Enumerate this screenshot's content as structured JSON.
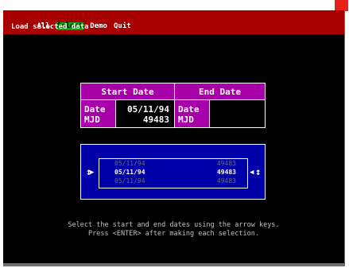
{
  "menu": {
    "items": [
      {
        "label": "All",
        "selected": false
      },
      {
        "label": "Select",
        "selected": true
      },
      {
        "label": "Demo",
        "selected": false
      },
      {
        "label": "Quit",
        "selected": false
      }
    ],
    "description": "Load selected data"
  },
  "dates": {
    "start_header": "Start Date",
    "end_header": "End Date",
    "label_date": "Date",
    "label_mjd": "MJD",
    "start_date": "05/11/94",
    "start_mjd": "49483",
    "end_date": "",
    "end_mjd": ""
  },
  "picker": {
    "rows": [
      {
        "date": "05/11/94",
        "mjd": "49483",
        "state": "dim"
      },
      {
        "date": "05/11/94",
        "mjd": "49483",
        "state": "current"
      },
      {
        "date": "05/11/94",
        "mjd": "49483",
        "state": "dim"
      }
    ]
  },
  "instructions": {
    "line1": "Select the start and end dates using the arrow keys.",
    "line2": "Press <ENTER> after making each selection."
  },
  "colors": {
    "menu_bg": "#a80000",
    "menu_selected": "#00a800",
    "magenta": "#a800a8",
    "blue": "#0000a8"
  }
}
